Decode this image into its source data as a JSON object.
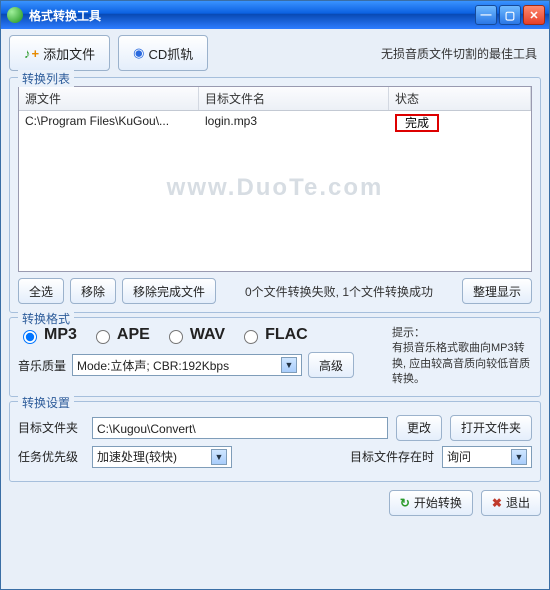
{
  "window": {
    "title": "格式转换工具"
  },
  "top": {
    "add_file": "添加文件",
    "cd_rip": "CD抓轨",
    "slogan": "无损音质文件切割的最佳工具"
  },
  "list_group": {
    "legend": "转换列表"
  },
  "list": {
    "headers": {
      "src": "源文件",
      "tgt": "目标文件名",
      "status": "状态"
    },
    "rows": [
      {
        "src": "C:\\Program Files\\KuGou\\...",
        "tgt": "login.mp3",
        "status": "完成"
      }
    ],
    "watermark": "www.DuoTe.com"
  },
  "list_actions": {
    "select_all": "全选",
    "remove": "移除",
    "remove_done": "移除完成文件",
    "status_text": "0个文件转换失败, 1个文件转换成功",
    "neat_display": "整理显示"
  },
  "format_group": {
    "legend": "转换格式",
    "options": [
      "MP3",
      "APE",
      "WAV",
      "FLAC"
    ],
    "selected": "MP3",
    "tips_label": "提示：",
    "tips_text": "有损音乐格式歌曲向MP3转换, 应由较高音质向较低音质转换。",
    "quality_label": "音乐质量",
    "quality_value": "Mode:立体声; CBR:192Kbps",
    "advanced": "高级"
  },
  "settings_group": {
    "legend": "转换设置",
    "dest_label": "目标文件夹",
    "dest_value": "C:\\Kugou\\Convert\\",
    "change": "更改",
    "open_folder": "打开文件夹",
    "priority_label": "任务优先级",
    "priority_value": "加速处理(较快)",
    "exist_label": "目标文件存在时",
    "exist_value": "询问"
  },
  "footer": {
    "start": "开始转换",
    "exit": "退出"
  }
}
